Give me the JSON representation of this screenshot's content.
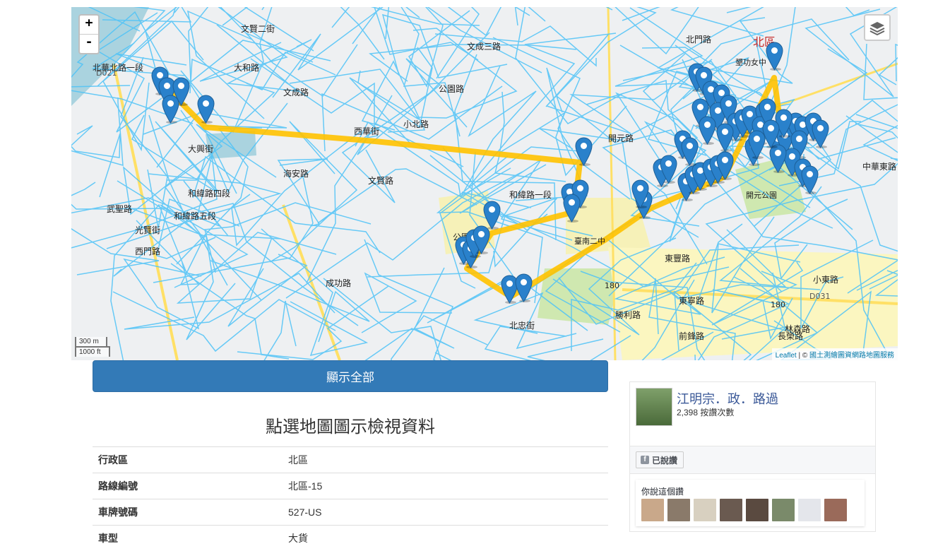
{
  "map": {
    "zoom_in": "+",
    "zoom_out": "-",
    "scale_metric": "300 m",
    "scale_imperial": "1000 ft",
    "attribution_lib": "Leaflet",
    "attribution_sep": " | © ",
    "attribution_src": "國土測繪圖資網路地圖服務",
    "district_label": "北區",
    "school_label": "墾功女中",
    "park_label": "開元公園",
    "station_label": "臺南二中",
    "road_labels": [
      "北華北路一段",
      "文賢二街",
      "文成三路",
      "大和路",
      "文成路",
      "大興街",
      "和緯路四段",
      "武聖路",
      "和緯路五段",
      "西門路",
      "光賢街",
      "公園南路",
      "成功路",
      "北忠街",
      "東豐路",
      "小東路",
      "東寧路",
      "勝利路",
      "前鋒路",
      "林森路",
      "中華東路",
      "長榮路",
      "北門路",
      "開元路",
      "和緯路一段",
      "小北路",
      "西華街",
      "海安路",
      "文賢路",
      "公園路"
    ],
    "road_numbers": [
      "180",
      "180",
      "D031",
      "D021"
    ],
    "map_colors": {
      "route": "#ffc200",
      "tracks": "#4fc3f7",
      "marker": "#2a81cb",
      "park": "#cfe8b0",
      "school": "#f6f1b8"
    }
  },
  "show_all_button": "顯示全部",
  "info": {
    "title": "點選地圖圖示檢視資料",
    "rows": [
      {
        "key": "行政區",
        "value": "北區"
      },
      {
        "key": "路線編號",
        "value": "北區-15"
      },
      {
        "key": "車牌號碼",
        "value": "527-US"
      },
      {
        "key": "車型",
        "value": "大貨"
      }
    ]
  },
  "facebook": {
    "page_name": "江明宗．政．路過",
    "likes": "2,398 按讚次數",
    "like_button": "已說讚",
    "friends_label": "你說這個讚",
    "friend_colors": [
      "#c9a88a",
      "#8a7a6a",
      "#d8d0c0",
      "#6a5a50",
      "#5a4a40",
      "#7a8a6a",
      "#e4e6eb",
      "#9a6a5a"
    ]
  }
}
